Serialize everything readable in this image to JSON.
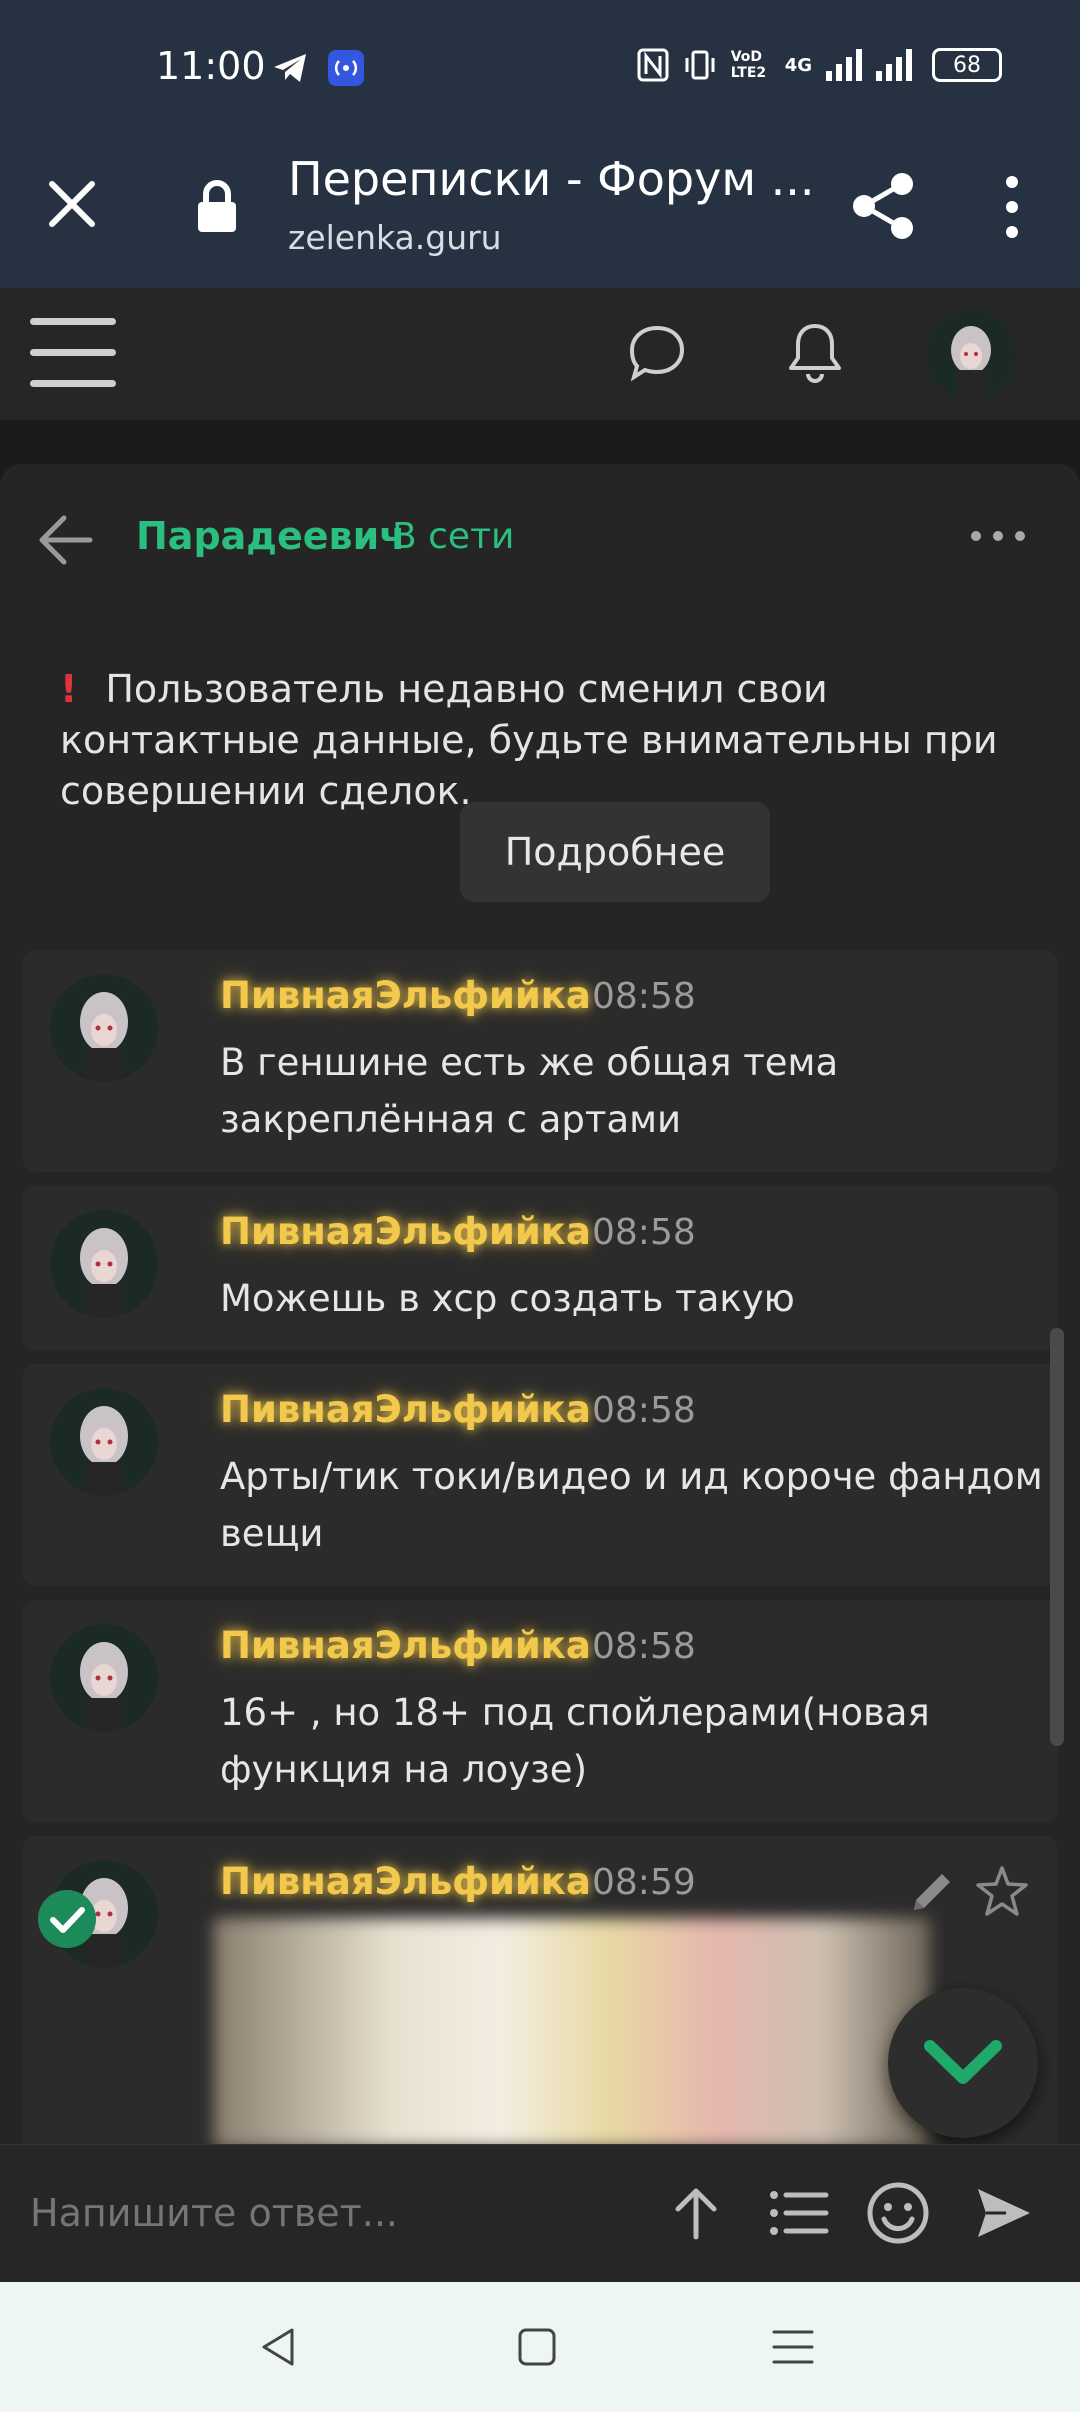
{
  "status_bar": {
    "time": "11:00",
    "battery": "68",
    "network": "4G",
    "volte": "VoD LTE2"
  },
  "browser": {
    "title": "Переписки - Форум ...",
    "url": "zelenka.guru"
  },
  "chat": {
    "partner_name": "Парадеевич",
    "partner_status": "В сети",
    "warning_icon": "!",
    "warning_text": "Пользователь недавно сменил свои контактные данные, будьте внимательны при совершении сделок.",
    "more_button": "Подробнее"
  },
  "messages": [
    {
      "author": "ПивнаяЭльфийка",
      "time": "08:58",
      "text": "В геншине есть же общая тема закреплённая с артами"
    },
    {
      "author": "ПивнаяЭльфийка",
      "time": "08:58",
      "text": "Можешь в хср создать такую"
    },
    {
      "author": "ПивнаяЭльфийка",
      "time": "08:58",
      "text": "Арты/тик токи/видео и ид короче фандом вещи"
    },
    {
      "author": "ПивнаяЭльфийка",
      "time": "08:58",
      "text": "16+ , но 18+ под спойлерами(новая функция на лоузе)"
    },
    {
      "author": "ПивнаяЭльфийка",
      "time": "08:59",
      "text": ""
    }
  ],
  "composer": {
    "placeholder": "Напишите ответ..."
  },
  "colors": {
    "accent_green": "#2bbf7f",
    "author_gold": "#f2c94c",
    "warning_red": "#e0343c",
    "topbar_blue": "#263241"
  }
}
